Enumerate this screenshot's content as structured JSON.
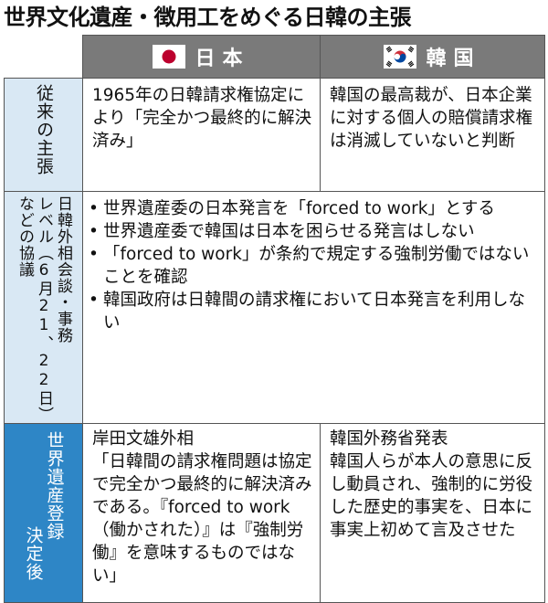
{
  "title": "世界文化遺産・徴用工をめぐる日韓の主張",
  "columns": {
    "japan": "日本",
    "korea": "韓国"
  },
  "rows": {
    "row1": {
      "label": "従来の主張",
      "japan": "1965年の日韓請求権協定により「完全かつ最終的に解決済み」",
      "korea": "韓国の最高裁が、日本企業に対する個人の賠償請求権は消滅していないと判断"
    },
    "row2": {
      "label_a": "などの協議",
      "label_b": "レベル（6月21、22日）",
      "label_c": "日韓外相会談・事務",
      "items": [
        "世界遺産委の日本発言を「forced to work」とする",
        "世界遺産委で韓国は日本を困らせる発言はしない",
        "「forced to work」が条約で規定する強制労働ではないことを確認",
        "韓国政府は日韓間の請求権において日本発言を利用しない"
      ]
    },
    "row3": {
      "label_a": "世界遺産登録",
      "label_b": "決定後",
      "japan_title": "岸田文雄外相",
      "japan": "「日韓間の請求権問題は協定で完全かつ最終的に解決済みである。『forced to work（働かされた）』は『強制労働』を意味するものではない」",
      "korea_title": "韓国外務省発表",
      "korea": "韓国人らが本人の意思に反し動員され、強制的に労役した歴史的事実を、日本に事実上初めて言及させた"
    }
  },
  "colors": {
    "header_bg": "#7a7a7a",
    "side_light": "#d9e8f4",
    "side_dark": "#2e86c6",
    "japan_red": "#bc002d",
    "korea_red": "#cd2e3a",
    "korea_blue": "#0047a0"
  },
  "icons": [
    "japan-flag-icon",
    "korea-flag-icon"
  ]
}
